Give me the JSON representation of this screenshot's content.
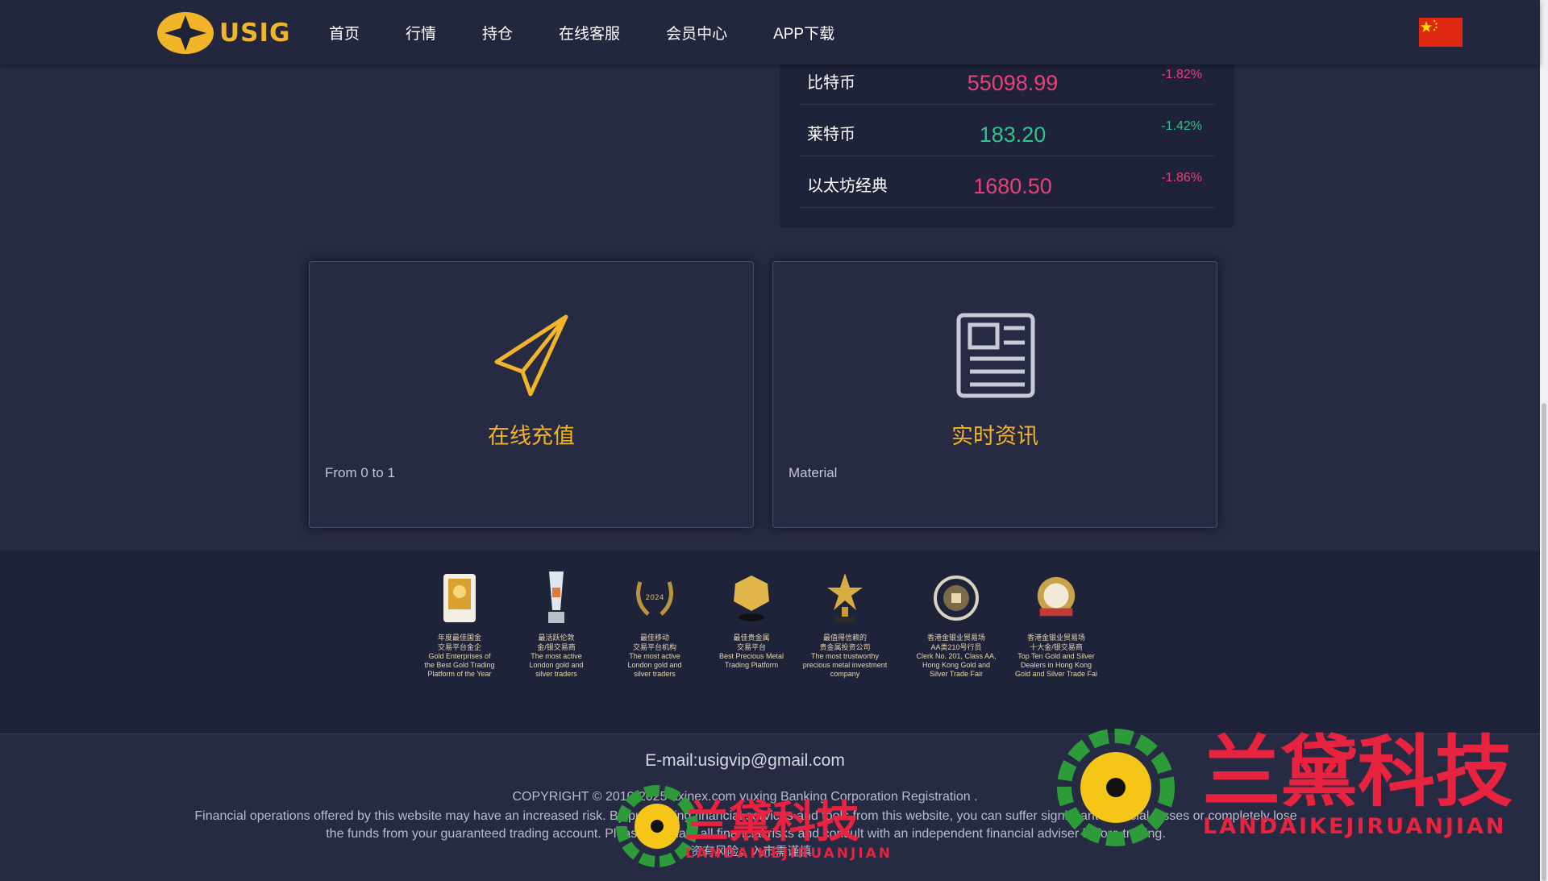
{
  "header": {
    "logo_text": "USIG",
    "nav": [
      "首页",
      "行情",
      "持仓",
      "在线客服",
      "会员中心",
      "APP下载"
    ],
    "flag_icon": "china-flag-icon"
  },
  "ticker": [
    {
      "name": "比特币",
      "price": "55098.99",
      "change": "-1.82%",
      "price_color": "#e8417a",
      "change_color": "#e8417a"
    },
    {
      "name": "莱特币",
      "price": "183.20",
      "change": "-1.42%",
      "price_color": "#2fc48d",
      "change_color": "#2fc48d"
    },
    {
      "name": "以太坊经典",
      "price": "1680.50",
      "change": "-1.86%",
      "price_color": "#e8417a",
      "change_color": "#e8417a"
    }
  ],
  "cards": [
    {
      "title": "在线充值",
      "sub": "From 0 to 1",
      "icon": "paper-plane-icon"
    },
    {
      "title": "实时资讯",
      "sub": "Material",
      "icon": "newspaper-icon"
    }
  ],
  "awards": [
    {
      "cn": "年度最佳国金\n交易平台金企",
      "en": "Gold Enterprises of\nthe Best Gold Trading\nPlatform of the Year",
      "icon": "gold-plaque-icon"
    },
    {
      "cn": "最活跃伦敦\n金/银交易商",
      "en": "The most active\nLondon gold and\nsilver traders",
      "icon": "crystal-trophy-icon"
    },
    {
      "cn": "最佳移动\n交易平台机构",
      "en": "The most active\nLondon gold and\nsilver traders",
      "icon": "laurel-wreath-icon"
    },
    {
      "cn": "最佳贵金属\n交易平台",
      "en": "Best Precious Metal\nTrading Platform",
      "icon": "gold-medal-icon"
    },
    {
      "cn": "最值得信赖的\n贵金属投资公司",
      "en": "The most trustworthy\nprecious metal investment\ncompany",
      "icon": "star-trophy-icon"
    },
    {
      "cn": "香港金银业贸易场\nAA类210号行员",
      "en": "Clerk No. 201, Class AA,\nHong Kong Gold and\nSilver Trade Fair",
      "icon": "exchange-seal-icon"
    },
    {
      "cn": "香港金银业贸易场\n十大金/银交易商",
      "en": "Top Ten Gold and Silver\nDealers in Hong Kong\nGold and Silver Trade Fai",
      "icon": "red-seal-badge-icon"
    }
  ],
  "footer": {
    "email": "E-mail:usigvip@gmail.com",
    "copyright": "COPYRIGHT © 2010-2025 axinex.com yuxing Banking Corporation Registration .",
    "disclaimer": "Financial operations offered by this website may have an increased risk. By purchasing financial services and tools from this website, you can suffer significant financial losses or completely lose the funds from your guaranteed trading account. Please evaluate all financial risks and consult with an independent financial adviser before trading.",
    "risk": "投资有风险，入市需谨慎"
  },
  "watermark": {
    "text": "兰黛科技",
    "sub": "LANDAIKEJIRUANJIAN"
  }
}
